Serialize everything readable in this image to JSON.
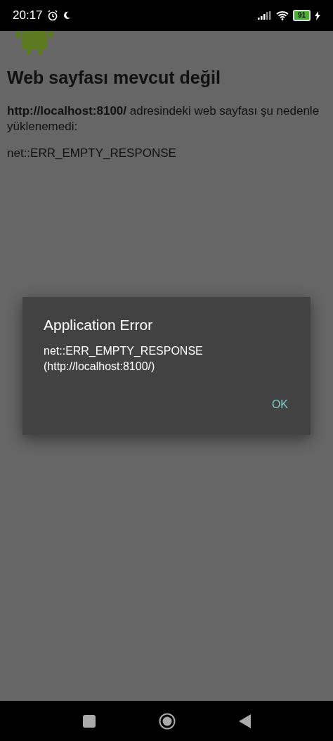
{
  "status_bar": {
    "time": "20:17",
    "battery": "91"
  },
  "page": {
    "title": "Web sayfası mevcut değil",
    "message": "**http://localhost:8100/** adresindeki web sayfası şu nedenle yüklenemedi:",
    "error": "net::ERR_EMPTY_RESPONSE"
  },
  "dialog": {
    "title": "Application Error",
    "message": "net::ERR_EMPTY_RESPONSE (http://localhost:8100/)",
    "buttons": [
      "OK"
    ]
  }
}
